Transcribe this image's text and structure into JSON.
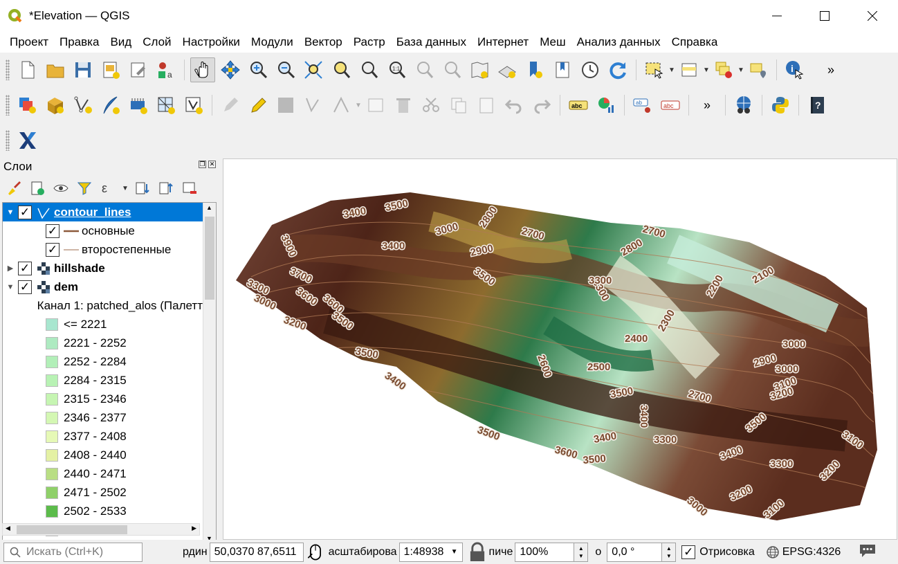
{
  "window": {
    "title": "*Elevation — QGIS"
  },
  "menu": [
    "Проект",
    "Правка",
    "Вид",
    "Слой",
    "Настройки",
    "Модули",
    "Вектор",
    "Растр",
    "База данных",
    "Интернет",
    "Меш",
    "Анализ данных",
    "Справка"
  ],
  "layers_panel": {
    "title": "Слои",
    "items": [
      {
        "name": "contour_lines",
        "checked": "✓",
        "selected": true
      },
      {
        "name": "основные",
        "checked": "✓"
      },
      {
        "name": "второстепенные",
        "checked": "✓"
      },
      {
        "name": "hillshade",
        "checked": "✓"
      },
      {
        "name": "dem",
        "checked": "✓"
      }
    ],
    "band_label": "Канал 1: patched_alos (Палетт",
    "legend": [
      {
        "label": "<= 2221",
        "color": "#a8e6cf"
      },
      {
        "label": "2221 - 2252",
        "color": "#aeeac1"
      },
      {
        "label": "2252 - 2284",
        "color": "#b2efb8"
      },
      {
        "label": "2284 - 2315",
        "color": "#b8f2b4"
      },
      {
        "label": "2315 - 2346",
        "color": "#c6f5b2"
      },
      {
        "label": "2346 - 2377",
        "color": "#d4f7b3"
      },
      {
        "label": "2377 - 2408",
        "color": "#e6f9b6"
      },
      {
        "label": "2408 - 2440",
        "color": "#e4f1a4"
      },
      {
        "label": "2440 - 2471",
        "color": "#b9de84"
      },
      {
        "label": "2471 - 2502",
        "color": "#8fd069"
      },
      {
        "label": "2502 - 2533",
        "color": "#5cbc4b"
      },
      {
        "label": "",
        "color": "#3ea23d"
      }
    ]
  },
  "map_labels": [
    "3400",
    "3500",
    "3900",
    "3000",
    "2800",
    "2700",
    "2700",
    "3400",
    "2900",
    "2800",
    "3700",
    "3500",
    "3300",
    "3300",
    "3300",
    "2200",
    "2100",
    "3000",
    "3600",
    "3600",
    "3200",
    "3500",
    "2400",
    "2300",
    "3000",
    "2600",
    "2500",
    "2900",
    "3000",
    "3500",
    "3100",
    "3400",
    "3500",
    "3200",
    "3400",
    "2700",
    "3500",
    "3400",
    "3300",
    "3500",
    "3100",
    "3600",
    "3500",
    "3400",
    "3300",
    "3000",
    "3200",
    "3100",
    "3200"
  ],
  "status": {
    "search_placeholder": "Искать (Ctrl+K)",
    "coord_label": "рдин",
    "coord_value": "50,0370 87,6511",
    "scale_label": "асштабирова",
    "scale_value": "1:48938",
    "magnifier_label": "пиче",
    "magnifier_value": "100%",
    "rotation_label": "о",
    "rotation_value": "0,0 °",
    "render_checked": "✓",
    "render_label": "Отрисовка",
    "crs": "EPSG:4326"
  }
}
